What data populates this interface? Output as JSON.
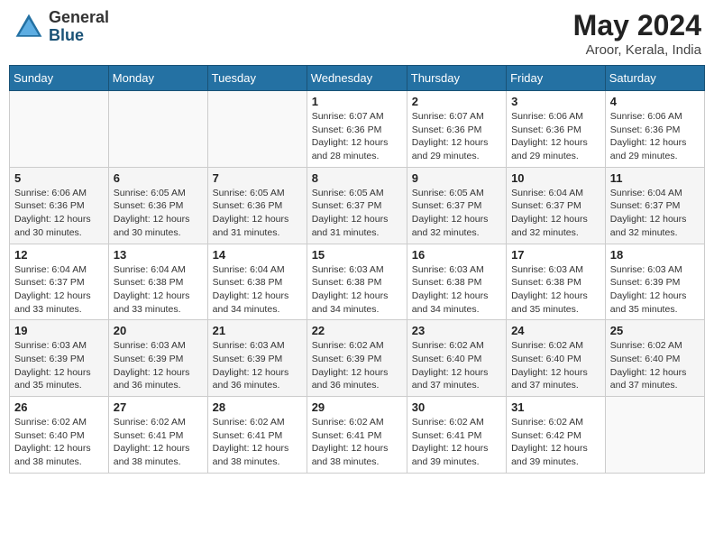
{
  "header": {
    "logo_general": "General",
    "logo_blue": "Blue",
    "month_year": "May 2024",
    "location": "Aroor, Kerala, India"
  },
  "days_of_week": [
    "Sunday",
    "Monday",
    "Tuesday",
    "Wednesday",
    "Thursday",
    "Friday",
    "Saturday"
  ],
  "weeks": [
    [
      {
        "day": "",
        "info": ""
      },
      {
        "day": "",
        "info": ""
      },
      {
        "day": "",
        "info": ""
      },
      {
        "day": "1",
        "info": "Sunrise: 6:07 AM\nSunset: 6:36 PM\nDaylight: 12 hours\nand 28 minutes."
      },
      {
        "day": "2",
        "info": "Sunrise: 6:07 AM\nSunset: 6:36 PM\nDaylight: 12 hours\nand 29 minutes."
      },
      {
        "day": "3",
        "info": "Sunrise: 6:06 AM\nSunset: 6:36 PM\nDaylight: 12 hours\nand 29 minutes."
      },
      {
        "day": "4",
        "info": "Sunrise: 6:06 AM\nSunset: 6:36 PM\nDaylight: 12 hours\nand 29 minutes."
      }
    ],
    [
      {
        "day": "5",
        "info": "Sunrise: 6:06 AM\nSunset: 6:36 PM\nDaylight: 12 hours\nand 30 minutes."
      },
      {
        "day": "6",
        "info": "Sunrise: 6:05 AM\nSunset: 6:36 PM\nDaylight: 12 hours\nand 30 minutes."
      },
      {
        "day": "7",
        "info": "Sunrise: 6:05 AM\nSunset: 6:36 PM\nDaylight: 12 hours\nand 31 minutes."
      },
      {
        "day": "8",
        "info": "Sunrise: 6:05 AM\nSunset: 6:37 PM\nDaylight: 12 hours\nand 31 minutes."
      },
      {
        "day": "9",
        "info": "Sunrise: 6:05 AM\nSunset: 6:37 PM\nDaylight: 12 hours\nand 32 minutes."
      },
      {
        "day": "10",
        "info": "Sunrise: 6:04 AM\nSunset: 6:37 PM\nDaylight: 12 hours\nand 32 minutes."
      },
      {
        "day": "11",
        "info": "Sunrise: 6:04 AM\nSunset: 6:37 PM\nDaylight: 12 hours\nand 32 minutes."
      }
    ],
    [
      {
        "day": "12",
        "info": "Sunrise: 6:04 AM\nSunset: 6:37 PM\nDaylight: 12 hours\nand 33 minutes."
      },
      {
        "day": "13",
        "info": "Sunrise: 6:04 AM\nSunset: 6:38 PM\nDaylight: 12 hours\nand 33 minutes."
      },
      {
        "day": "14",
        "info": "Sunrise: 6:04 AM\nSunset: 6:38 PM\nDaylight: 12 hours\nand 34 minutes."
      },
      {
        "day": "15",
        "info": "Sunrise: 6:03 AM\nSunset: 6:38 PM\nDaylight: 12 hours\nand 34 minutes."
      },
      {
        "day": "16",
        "info": "Sunrise: 6:03 AM\nSunset: 6:38 PM\nDaylight: 12 hours\nand 34 minutes."
      },
      {
        "day": "17",
        "info": "Sunrise: 6:03 AM\nSunset: 6:38 PM\nDaylight: 12 hours\nand 35 minutes."
      },
      {
        "day": "18",
        "info": "Sunrise: 6:03 AM\nSunset: 6:39 PM\nDaylight: 12 hours\nand 35 minutes."
      }
    ],
    [
      {
        "day": "19",
        "info": "Sunrise: 6:03 AM\nSunset: 6:39 PM\nDaylight: 12 hours\nand 35 minutes."
      },
      {
        "day": "20",
        "info": "Sunrise: 6:03 AM\nSunset: 6:39 PM\nDaylight: 12 hours\nand 36 minutes."
      },
      {
        "day": "21",
        "info": "Sunrise: 6:03 AM\nSunset: 6:39 PM\nDaylight: 12 hours\nand 36 minutes."
      },
      {
        "day": "22",
        "info": "Sunrise: 6:02 AM\nSunset: 6:39 PM\nDaylight: 12 hours\nand 36 minutes."
      },
      {
        "day": "23",
        "info": "Sunrise: 6:02 AM\nSunset: 6:40 PM\nDaylight: 12 hours\nand 37 minutes."
      },
      {
        "day": "24",
        "info": "Sunrise: 6:02 AM\nSunset: 6:40 PM\nDaylight: 12 hours\nand 37 minutes."
      },
      {
        "day": "25",
        "info": "Sunrise: 6:02 AM\nSunset: 6:40 PM\nDaylight: 12 hours\nand 37 minutes."
      }
    ],
    [
      {
        "day": "26",
        "info": "Sunrise: 6:02 AM\nSunset: 6:40 PM\nDaylight: 12 hours\nand 38 minutes."
      },
      {
        "day": "27",
        "info": "Sunrise: 6:02 AM\nSunset: 6:41 PM\nDaylight: 12 hours\nand 38 minutes."
      },
      {
        "day": "28",
        "info": "Sunrise: 6:02 AM\nSunset: 6:41 PM\nDaylight: 12 hours\nand 38 minutes."
      },
      {
        "day": "29",
        "info": "Sunrise: 6:02 AM\nSunset: 6:41 PM\nDaylight: 12 hours\nand 38 minutes."
      },
      {
        "day": "30",
        "info": "Sunrise: 6:02 AM\nSunset: 6:41 PM\nDaylight: 12 hours\nand 39 minutes."
      },
      {
        "day": "31",
        "info": "Sunrise: 6:02 AM\nSunset: 6:42 PM\nDaylight: 12 hours\nand 39 minutes."
      },
      {
        "day": "",
        "info": ""
      }
    ]
  ]
}
